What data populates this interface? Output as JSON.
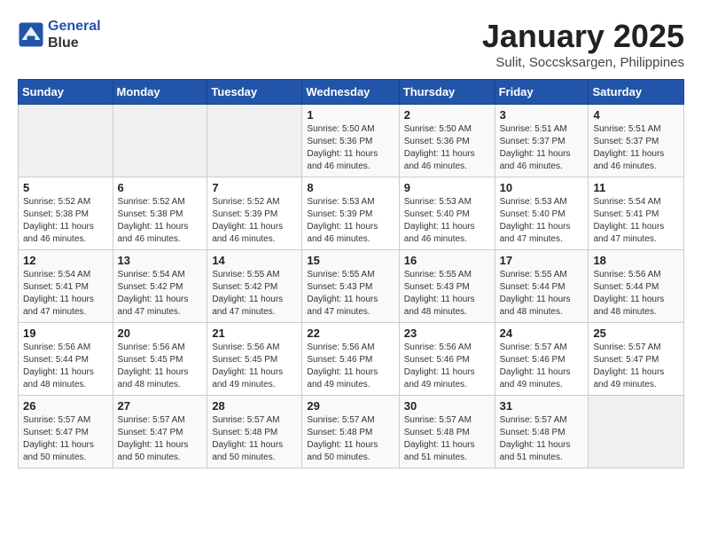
{
  "header": {
    "logo_line1": "General",
    "logo_line2": "Blue",
    "month": "January 2025",
    "location": "Sulit, Soccsksargen, Philippines"
  },
  "days_of_week": [
    "Sunday",
    "Monday",
    "Tuesday",
    "Wednesday",
    "Thursday",
    "Friday",
    "Saturday"
  ],
  "weeks": [
    [
      {
        "day": "",
        "info": ""
      },
      {
        "day": "",
        "info": ""
      },
      {
        "day": "",
        "info": ""
      },
      {
        "day": "1",
        "info": "Sunrise: 5:50 AM\nSunset: 5:36 PM\nDaylight: 11 hours\nand 46 minutes."
      },
      {
        "day": "2",
        "info": "Sunrise: 5:50 AM\nSunset: 5:36 PM\nDaylight: 11 hours\nand 46 minutes."
      },
      {
        "day": "3",
        "info": "Sunrise: 5:51 AM\nSunset: 5:37 PM\nDaylight: 11 hours\nand 46 minutes."
      },
      {
        "day": "4",
        "info": "Sunrise: 5:51 AM\nSunset: 5:37 PM\nDaylight: 11 hours\nand 46 minutes."
      }
    ],
    [
      {
        "day": "5",
        "info": "Sunrise: 5:52 AM\nSunset: 5:38 PM\nDaylight: 11 hours\nand 46 minutes."
      },
      {
        "day": "6",
        "info": "Sunrise: 5:52 AM\nSunset: 5:38 PM\nDaylight: 11 hours\nand 46 minutes."
      },
      {
        "day": "7",
        "info": "Sunrise: 5:52 AM\nSunset: 5:39 PM\nDaylight: 11 hours\nand 46 minutes."
      },
      {
        "day": "8",
        "info": "Sunrise: 5:53 AM\nSunset: 5:39 PM\nDaylight: 11 hours\nand 46 minutes."
      },
      {
        "day": "9",
        "info": "Sunrise: 5:53 AM\nSunset: 5:40 PM\nDaylight: 11 hours\nand 46 minutes."
      },
      {
        "day": "10",
        "info": "Sunrise: 5:53 AM\nSunset: 5:40 PM\nDaylight: 11 hours\nand 47 minutes."
      },
      {
        "day": "11",
        "info": "Sunrise: 5:54 AM\nSunset: 5:41 PM\nDaylight: 11 hours\nand 47 minutes."
      }
    ],
    [
      {
        "day": "12",
        "info": "Sunrise: 5:54 AM\nSunset: 5:41 PM\nDaylight: 11 hours\nand 47 minutes."
      },
      {
        "day": "13",
        "info": "Sunrise: 5:54 AM\nSunset: 5:42 PM\nDaylight: 11 hours\nand 47 minutes."
      },
      {
        "day": "14",
        "info": "Sunrise: 5:55 AM\nSunset: 5:42 PM\nDaylight: 11 hours\nand 47 minutes."
      },
      {
        "day": "15",
        "info": "Sunrise: 5:55 AM\nSunset: 5:43 PM\nDaylight: 11 hours\nand 47 minutes."
      },
      {
        "day": "16",
        "info": "Sunrise: 5:55 AM\nSunset: 5:43 PM\nDaylight: 11 hours\nand 48 minutes."
      },
      {
        "day": "17",
        "info": "Sunrise: 5:55 AM\nSunset: 5:44 PM\nDaylight: 11 hours\nand 48 minutes."
      },
      {
        "day": "18",
        "info": "Sunrise: 5:56 AM\nSunset: 5:44 PM\nDaylight: 11 hours\nand 48 minutes."
      }
    ],
    [
      {
        "day": "19",
        "info": "Sunrise: 5:56 AM\nSunset: 5:44 PM\nDaylight: 11 hours\nand 48 minutes."
      },
      {
        "day": "20",
        "info": "Sunrise: 5:56 AM\nSunset: 5:45 PM\nDaylight: 11 hours\nand 48 minutes."
      },
      {
        "day": "21",
        "info": "Sunrise: 5:56 AM\nSunset: 5:45 PM\nDaylight: 11 hours\nand 49 minutes."
      },
      {
        "day": "22",
        "info": "Sunrise: 5:56 AM\nSunset: 5:46 PM\nDaylight: 11 hours\nand 49 minutes."
      },
      {
        "day": "23",
        "info": "Sunrise: 5:56 AM\nSunset: 5:46 PM\nDaylight: 11 hours\nand 49 minutes."
      },
      {
        "day": "24",
        "info": "Sunrise: 5:57 AM\nSunset: 5:46 PM\nDaylight: 11 hours\nand 49 minutes."
      },
      {
        "day": "25",
        "info": "Sunrise: 5:57 AM\nSunset: 5:47 PM\nDaylight: 11 hours\nand 49 minutes."
      }
    ],
    [
      {
        "day": "26",
        "info": "Sunrise: 5:57 AM\nSunset: 5:47 PM\nDaylight: 11 hours\nand 50 minutes."
      },
      {
        "day": "27",
        "info": "Sunrise: 5:57 AM\nSunset: 5:47 PM\nDaylight: 11 hours\nand 50 minutes."
      },
      {
        "day": "28",
        "info": "Sunrise: 5:57 AM\nSunset: 5:48 PM\nDaylight: 11 hours\nand 50 minutes."
      },
      {
        "day": "29",
        "info": "Sunrise: 5:57 AM\nSunset: 5:48 PM\nDaylight: 11 hours\nand 50 minutes."
      },
      {
        "day": "30",
        "info": "Sunrise: 5:57 AM\nSunset: 5:48 PM\nDaylight: 11 hours\nand 51 minutes."
      },
      {
        "day": "31",
        "info": "Sunrise: 5:57 AM\nSunset: 5:48 PM\nDaylight: 11 hours\nand 51 minutes."
      },
      {
        "day": "",
        "info": ""
      }
    ]
  ]
}
